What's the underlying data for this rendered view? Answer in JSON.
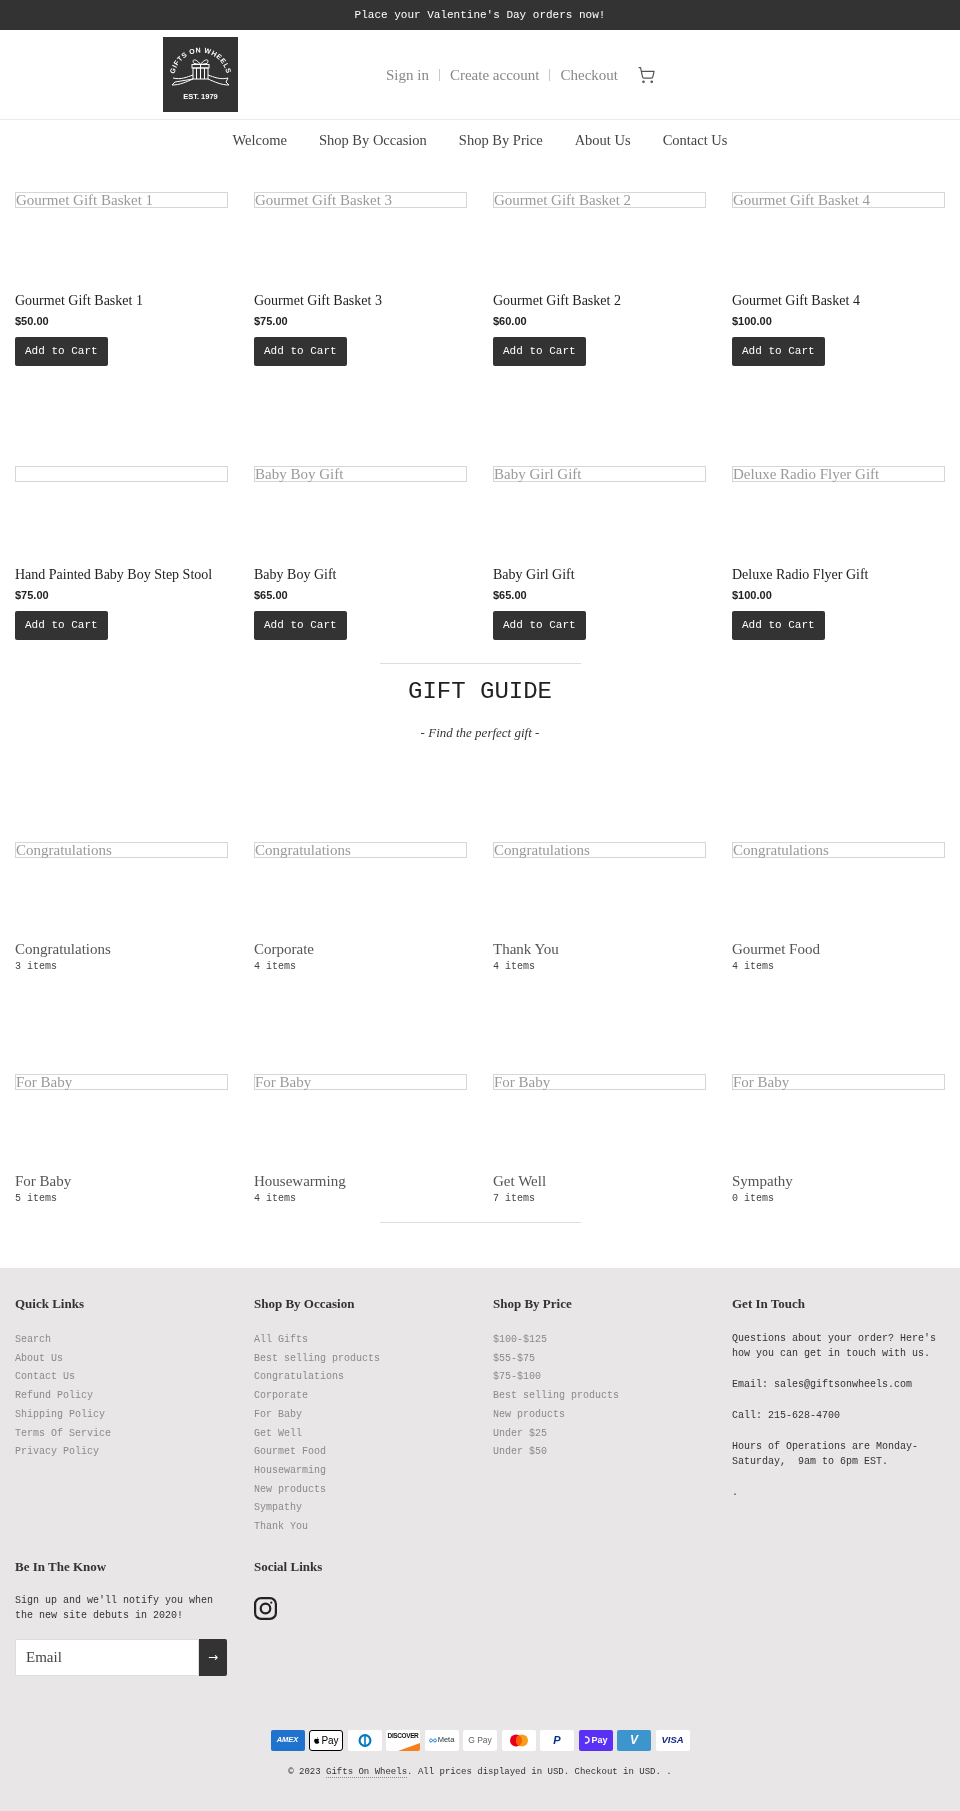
{
  "announcement": {
    "text": "Place your Valentine's Day orders now!"
  },
  "header": {
    "logo": {
      "name": "GIFTS ON WHEELS",
      "tagline": "EST. 1979"
    },
    "account_links": [
      "Sign in",
      "Create account",
      "Checkout"
    ]
  },
  "nav": {
    "items": [
      "Welcome",
      "Shop By Occasion",
      "Shop By Price",
      "About Us",
      "Contact Us"
    ]
  },
  "products": [
    {
      "image_alt": "Gourmet Gift Basket 1",
      "title": "Gourmet Gift Basket 1",
      "price": "$50.00",
      "button": "Add to Cart"
    },
    {
      "image_alt": "Gourmet Gift Basket 3",
      "title": "Gourmet Gift Basket 3",
      "price": "$75.00",
      "button": "Add to Cart"
    },
    {
      "image_alt": "Gourmet Gift Basket 2",
      "title": "Gourmet Gift Basket 2",
      "price": "$60.00",
      "button": "Add to Cart"
    },
    {
      "image_alt": "Gourmet Gift Basket 4",
      "title": "Gourmet Gift Basket 4",
      "price": "$100.00",
      "button": "Add to Cart"
    },
    {
      "title": "Hand Painted Baby Boy Step Stool",
      "price": "$75.00",
      "button": "Add to Cart"
    },
    {
      "image_alt": "Baby Boy Gift",
      "title": "Baby Boy Gift",
      "price": "$65.00",
      "button": "Add to Cart"
    },
    {
      "image_alt": "Baby Girl Gift",
      "title": "Baby Girl Gift",
      "price": "$65.00",
      "button": "Add to Cart"
    },
    {
      "image_alt": "Deluxe Radio Flyer Gift",
      "title": "Deluxe Radio Flyer Gift",
      "price": "$100.00",
      "button": "Add to Cart"
    }
  ],
  "gift_guide": {
    "title": "GIFT GUIDE",
    "subtitle": "- Find the perfect gift -",
    "collections": [
      {
        "image_alt": "Congratulations",
        "title": "Congratulations",
        "count": "3 items"
      },
      {
        "image_alt": "Congratulations",
        "title": "Corporate",
        "count": "4 items"
      },
      {
        "image_alt": "Congratulations",
        "title": "Thank You",
        "count": "4 items"
      },
      {
        "image_alt": "Congratulations",
        "title": "Gourmet Food",
        "count": "4 items"
      },
      {
        "image_alt": "For Baby",
        "title": "For Baby",
        "count": "5 items"
      },
      {
        "image_alt": "For Baby",
        "title": "Housewarming",
        "count": "4 items"
      },
      {
        "image_alt": "For Baby",
        "title": "Get Well",
        "count": "7 items"
      },
      {
        "image_alt": "For Baby",
        "title": "Sympathy",
        "count": "0 items"
      }
    ]
  },
  "footer": {
    "columns": [
      {
        "kind": "links",
        "heading": "Quick Links",
        "links": [
          "Search",
          "About Us",
          "Contact Us",
          "Refund Policy",
          "Shipping Policy",
          "Terms Of Service",
          "Privacy Policy"
        ]
      },
      {
        "kind": "links",
        "heading": "Shop By Occasion",
        "links": [
          "All Gifts",
          "Best selling products",
          "Congratulations",
          "Corporate",
          "For Baby",
          "Get Well",
          "Gourmet Food",
          "Housewarming",
          "New products",
          "Sympathy",
          "Thank You"
        ]
      },
      {
        "kind": "links",
        "heading": "Shop By Price",
        "links": [
          "$100-$125",
          "$55-$75",
          "$75-$100",
          "Best selling products",
          "New products",
          "Under $25",
          "Under $50"
        ]
      },
      {
        "kind": "text",
        "heading": "Get In Touch",
        "paragraphs": [
          "Questions about your order? Here's how you can get in touch with us.",
          "Email: sales@giftsonwheels.com",
          "Call: 215-628-4700",
          "Hours of Operations are Monday-Saturday,  9am to 6pm EST.",
          "."
        ]
      }
    ],
    "newsletter": {
      "heading": "Be In The Know",
      "text": "Sign up and we'll notify you when the new site debuts in 2020!",
      "email": {
        "placeholder": "Email"
      },
      "submit": "→"
    },
    "social": {
      "heading": "Social Links"
    },
    "payment_methods": [
      {
        "kind": "amex",
        "label": "AMEX"
      },
      {
        "kind": "applepay",
        "label": "Pay"
      },
      {
        "kind": "diners"
      },
      {
        "kind": "discover",
        "label": "DISCOVER"
      },
      {
        "kind": "meta",
        "label": "Meta"
      },
      {
        "kind": "gpay",
        "label": "G Pay"
      },
      {
        "kind": "mastercard"
      },
      {
        "kind": "paypal",
        "label": "P"
      },
      {
        "kind": "shoppay",
        "label": "Pay"
      },
      {
        "kind": "venmo",
        "label": "V"
      },
      {
        "kind": "visa",
        "label": "VISA"
      }
    ],
    "copyright": {
      "prefix": "© 2023 ",
      "link": "Gifts On Wheels",
      "suffix": ". All prices displayed in USD. Checkout in USD. ."
    }
  }
}
